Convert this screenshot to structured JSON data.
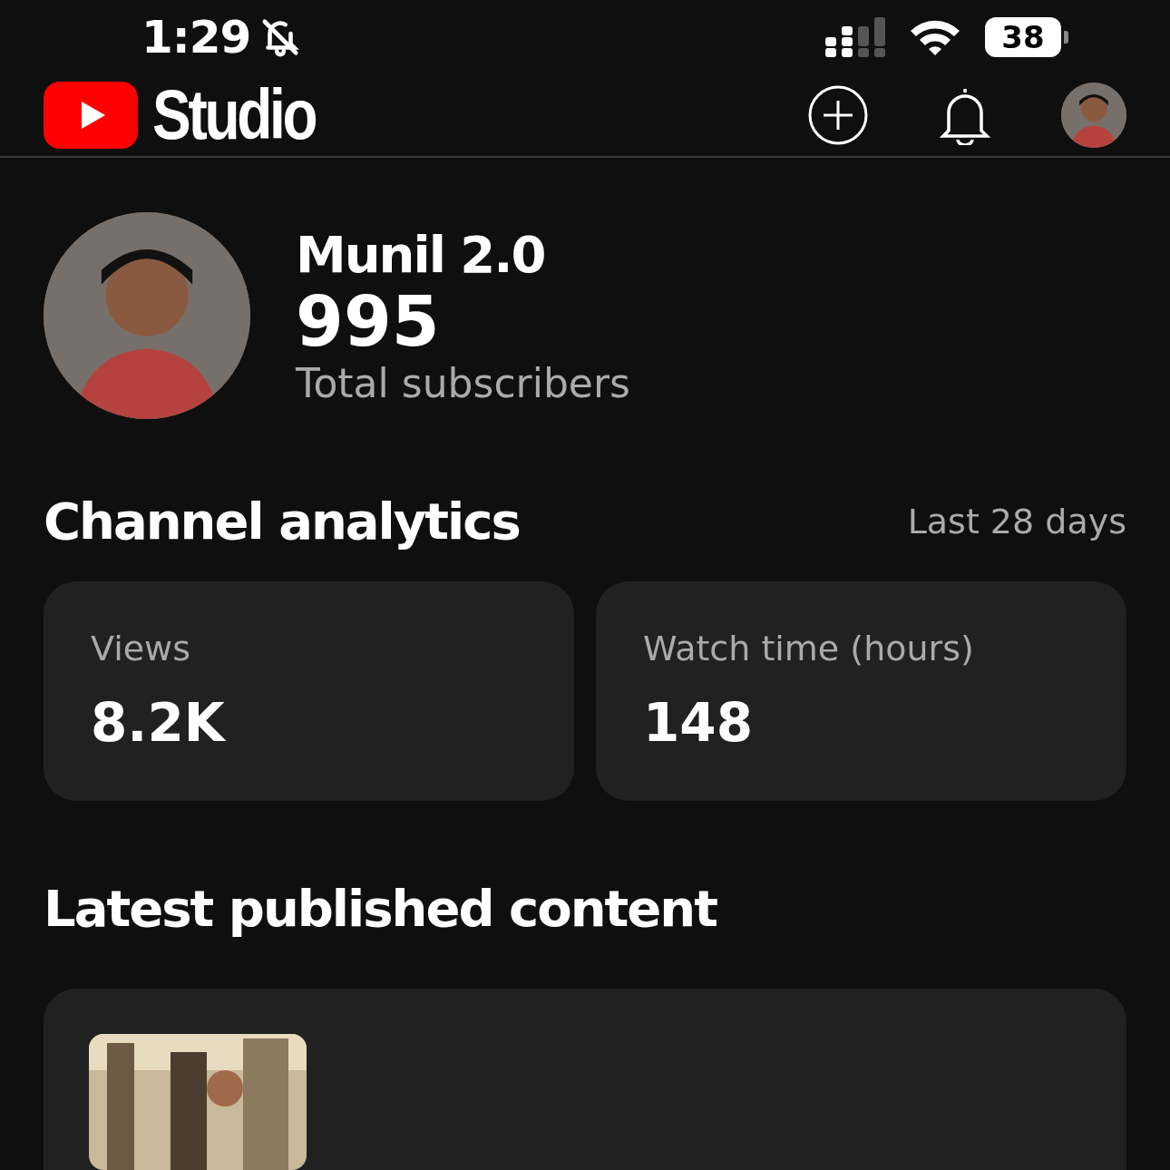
{
  "status_bar": {
    "time": "1:29",
    "battery": "38"
  },
  "header": {
    "logo_text": "Studio"
  },
  "channel": {
    "name": "Munil 2.0",
    "subscribers": "995",
    "subscribers_label": "Total subscribers"
  },
  "analytics": {
    "title": "Channel analytics",
    "period": "Last 28 days",
    "metrics": [
      {
        "label": "Views",
        "value": "8.2K"
      },
      {
        "label": "Watch time (hours)",
        "value": "148"
      }
    ]
  },
  "latest": {
    "title": "Latest published content"
  }
}
